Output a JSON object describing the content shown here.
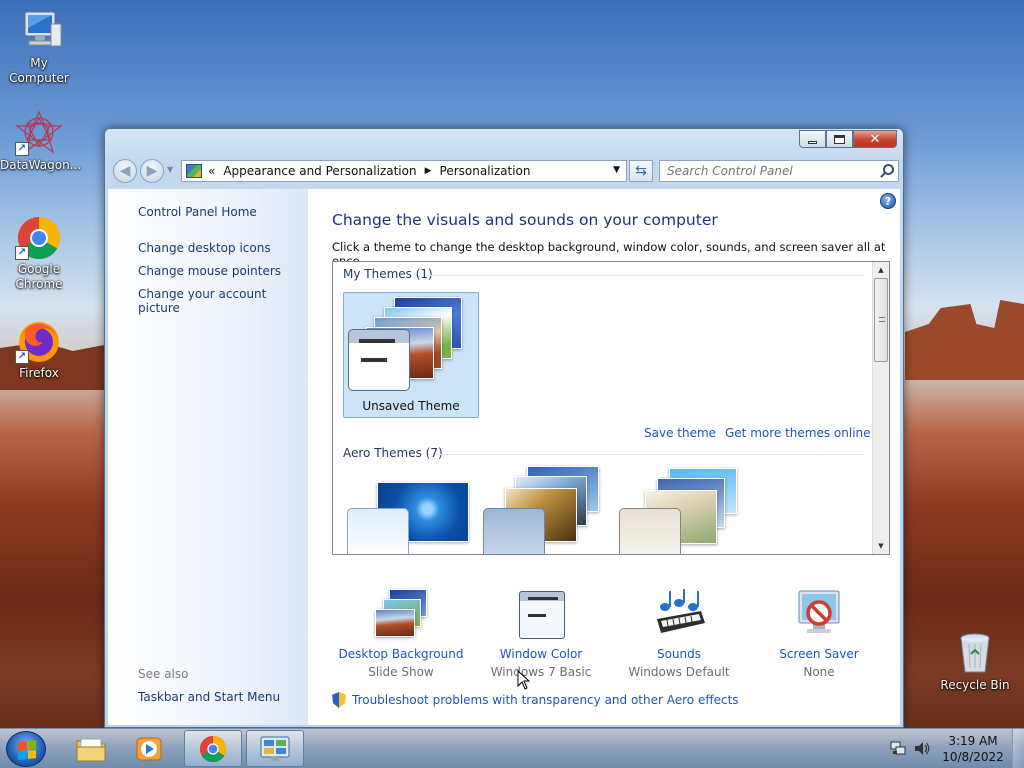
{
  "desktop": {
    "icons": [
      {
        "label": "My Computer"
      },
      {
        "label": "DataWagon..."
      },
      {
        "label": "Google Chrome"
      },
      {
        "label": "Firefox"
      },
      {
        "label": "Recycle Bin"
      }
    ]
  },
  "window": {
    "address": {
      "prefix": "«",
      "segments": [
        "Appearance and Personalization",
        "Personalization"
      ]
    },
    "search": {
      "placeholder": "Search Control Panel"
    },
    "left_pane": {
      "home": "Control Panel Home",
      "links": [
        "Change desktop icons",
        "Change mouse pointers",
        "Change your account picture"
      ],
      "see_also": "See also",
      "see_also_links": [
        "Taskbar and Start Menu"
      ]
    },
    "main": {
      "title": "Change the visuals and sounds on your computer",
      "subtitle": "Click a theme to change the desktop background, window color, sounds, and screen saver all at once.",
      "my_themes_header": "My Themes (1)",
      "selected_theme": "Unsaved Theme",
      "save_theme": "Save theme",
      "get_more": "Get more themes online",
      "aero_header": "Aero Themes (7)",
      "settings": [
        {
          "name": "Desktop Background",
          "value": "Slide Show",
          "icon": "desktop-background-icon"
        },
        {
          "name": "Window Color",
          "value": "Windows 7 Basic",
          "icon": "window-color-icon"
        },
        {
          "name": "Sounds",
          "value": "Windows Default",
          "icon": "sounds-icon"
        },
        {
          "name": "Screen Saver",
          "value": "None",
          "icon": "screen-saver-icon"
        }
      ],
      "troubleshoot": "Troubleshoot problems with transparency and other Aero effects"
    }
  },
  "taskbar": {
    "clock": {
      "time": "3:19 AM",
      "date": "10/8/2022"
    }
  },
  "colors": {
    "link": "#1c56b8",
    "title": "#1e3287",
    "selection": "#cce4f8",
    "close_button": "#c74a31"
  }
}
